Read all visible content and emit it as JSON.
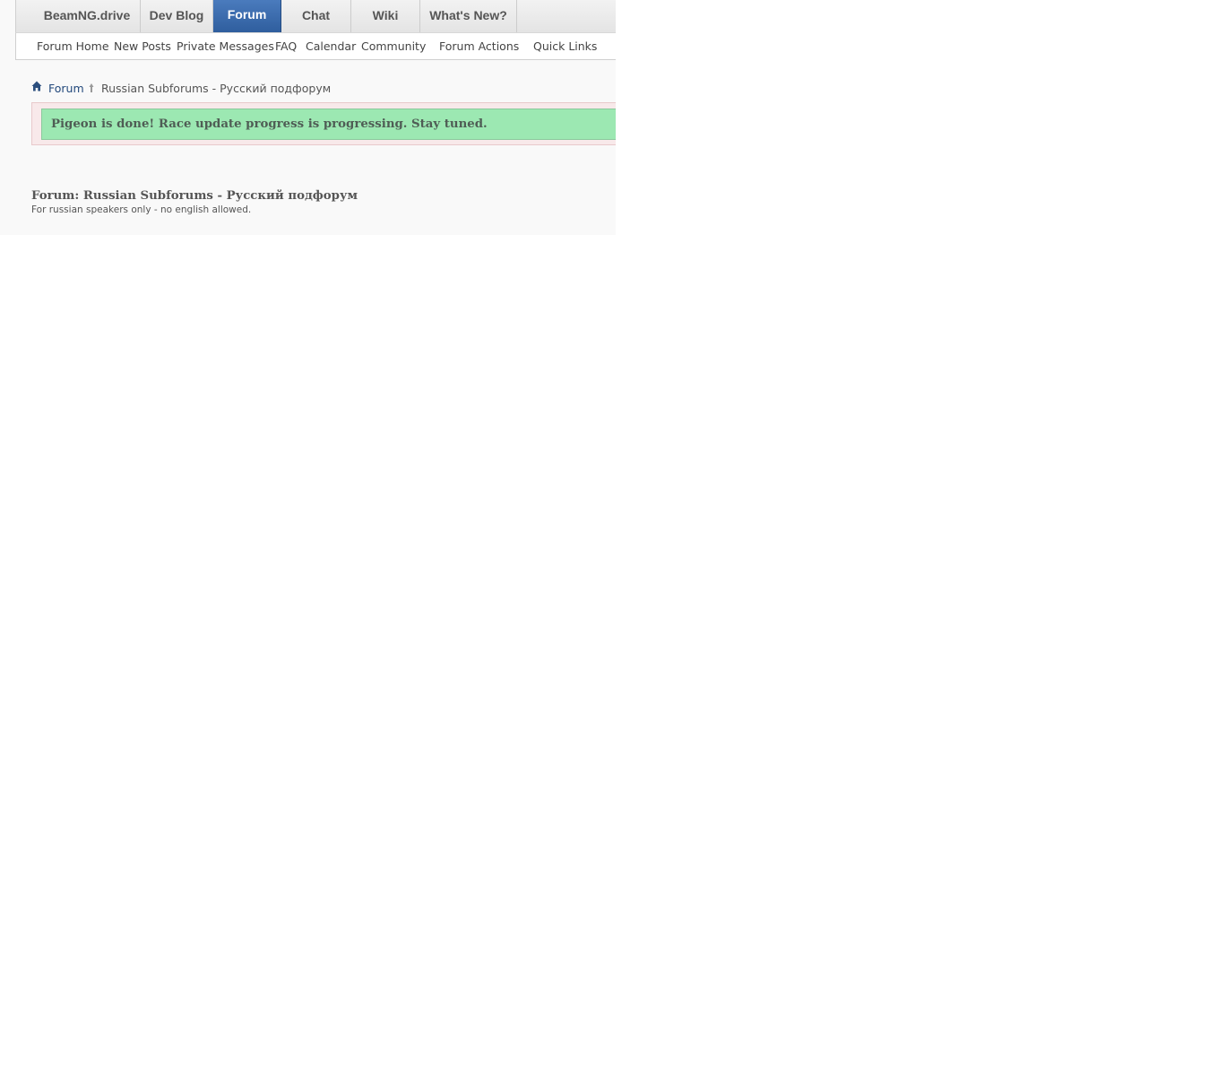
{
  "topnav": {
    "tabs": [
      {
        "label": "BeamNG.drive",
        "active": false
      },
      {
        "label": "Dev Blog",
        "active": false
      },
      {
        "label": "Forum",
        "active": true
      },
      {
        "label": "Chat",
        "active": false
      },
      {
        "label": "Wiki",
        "active": false
      },
      {
        "label": "What's New?",
        "active": false
      }
    ]
  },
  "subnav": {
    "items": [
      {
        "label": "Forum Home"
      },
      {
        "label": "New Posts"
      },
      {
        "label": "Private Messages"
      },
      {
        "label": "FAQ"
      },
      {
        "label": "Calendar"
      },
      {
        "label": "Community"
      },
      {
        "label": "Forum Actions"
      },
      {
        "label": "Quick Links"
      }
    ]
  },
  "breadcrumb": {
    "home_icon": "home-icon",
    "forum": "Forum",
    "current": "Russian Subforums - Русский подфорум"
  },
  "notice": {
    "text": "Pigeon is done! Race update progress is progressing. Stay tuned."
  },
  "forum_header": {
    "title": "Forum: Russian Subforums - Русский подфорум",
    "description": "For russian speakers only - no english allowed."
  },
  "colors": {
    "active_tab": "#2f5e9e",
    "link": "#23497c",
    "notice_bg": "#9ce8b2"
  }
}
